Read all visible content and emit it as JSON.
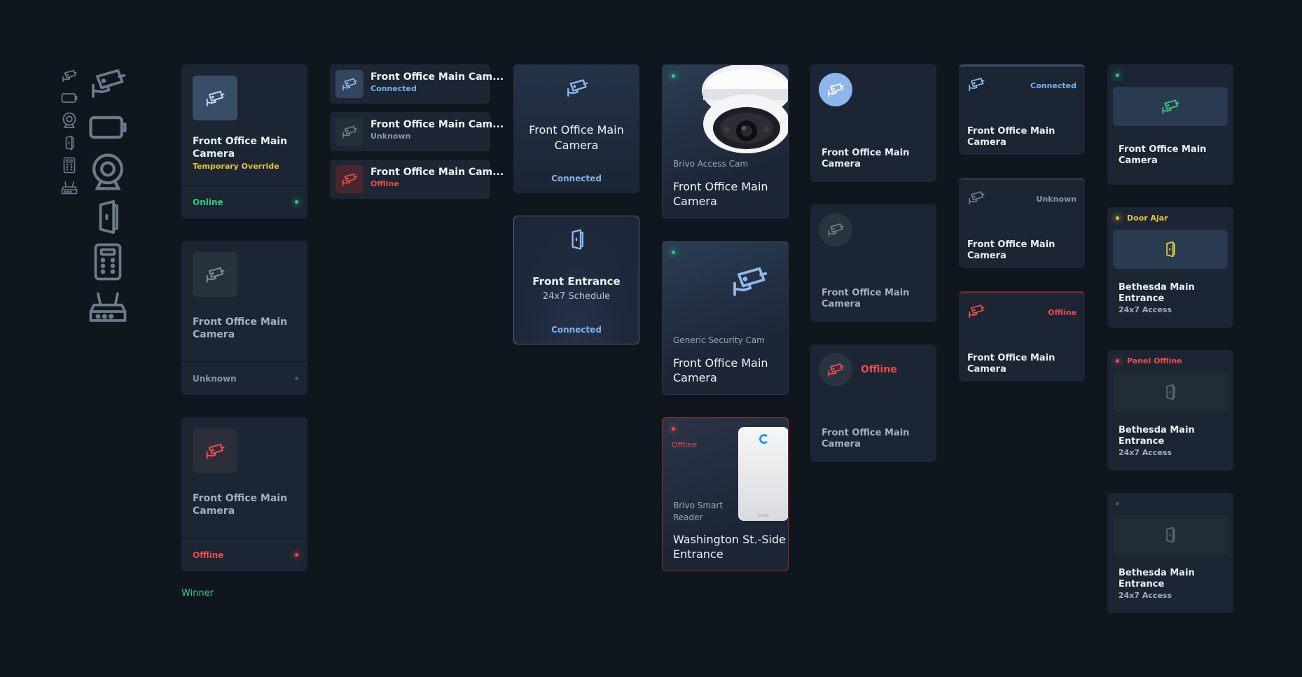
{
  "colors": {
    "background": "#10161e",
    "card": "#1b2533",
    "online": "#34c98a",
    "offline": "#ef4b4b",
    "warning": "#e8c33a",
    "connected": "#7fb2ee",
    "unknown": "#8896a6"
  },
  "icon_column": {
    "icons": [
      "camera-icon",
      "battery-icon",
      "webcam-icon",
      "door-icon",
      "keypad-icon",
      "router-icon"
    ]
  },
  "col1": {
    "card1": {
      "title": "Front Office Main Camera",
      "sub": "Temporary Override",
      "status": "Online"
    },
    "card2": {
      "title": "Front Office Main Camera",
      "status": "Unknown"
    },
    "card3": {
      "title": "Front Office Main Camera",
      "status": "Offline"
    },
    "winner": "Winner"
  },
  "col2": {
    "rows": [
      {
        "title": "Front Office Main Cam...",
        "status": "Connected"
      },
      {
        "title": "Front Office Main Cam...",
        "status": "Unknown"
      },
      {
        "title": "Front Office Main Cam...",
        "status": "Offline"
      }
    ]
  },
  "col3": {
    "card1": {
      "title": "Front Office Main Camera",
      "status": "Connected"
    },
    "card2": {
      "title": "Front Entrance",
      "sub": "24x7 Schedule",
      "status": "Connected"
    }
  },
  "col4": {
    "card1": {
      "product": "Brivo Access Cam",
      "title": "Front Office Main Camera"
    },
    "card2": {
      "product": "Generic Security Cam",
      "title": "Front Office Main Camera"
    },
    "card3": {
      "status": "Offline",
      "product": "Brivo Smart Reader",
      "title": "Washington St.-Side Entrance",
      "device_logo": "brivo"
    }
  },
  "col5": {
    "card1": {
      "title": "Front Office Main Camera"
    },
    "card2": {
      "title": "Front Office Main Camera"
    },
    "card3": {
      "status": "Offline",
      "title": "Front Office Main Camera"
    }
  },
  "col6": {
    "card1": {
      "status": "Connected",
      "title": "Front Office Main Camera"
    },
    "card2": {
      "status": "Unknown",
      "title": "Front Office Main Camera"
    },
    "card3": {
      "status": "Offline",
      "title": "Front Office Main Camera"
    }
  },
  "col7": {
    "card1": {
      "title": "Front Office Main Camera"
    },
    "card2": {
      "status": "Door Ajar",
      "title": "Bethesda Main Entrance",
      "sub": "24x7 Access"
    },
    "card3": {
      "status": "Panel Offline",
      "title": "Bethesda Main Entrance",
      "sub": "24x7 Access"
    },
    "card4": {
      "title": "Bethesda Main Entrance",
      "sub": "24x7 Access"
    }
  }
}
